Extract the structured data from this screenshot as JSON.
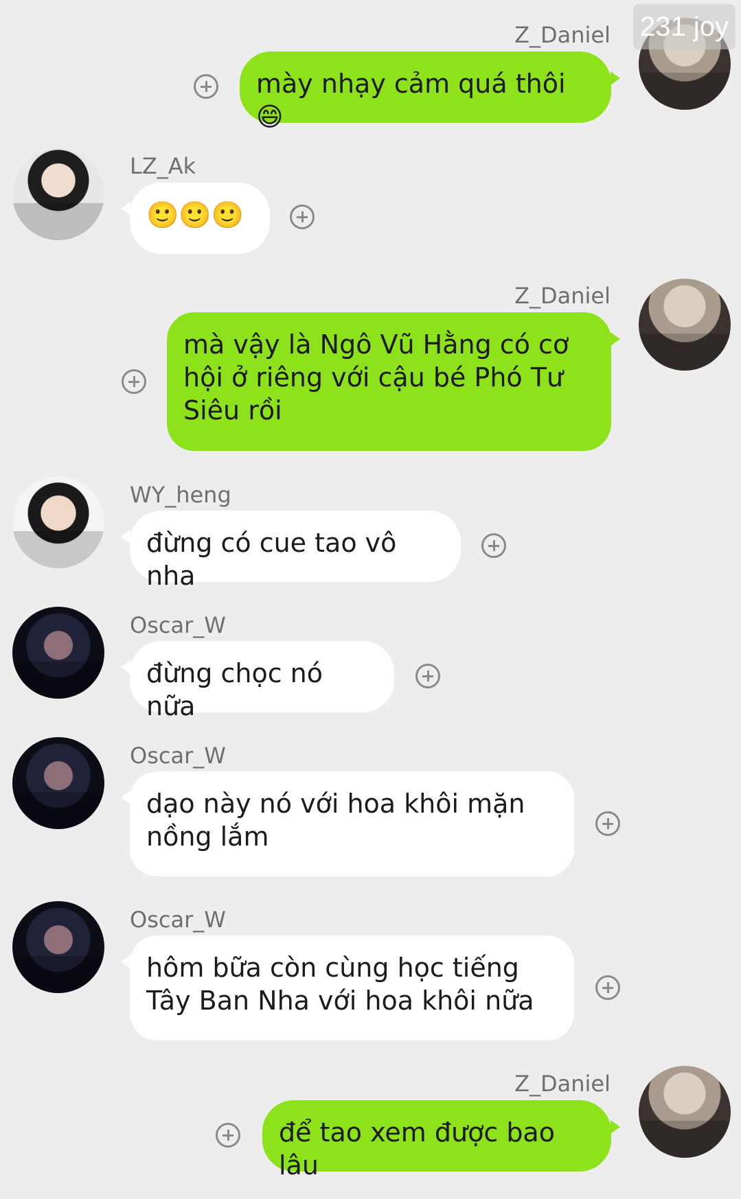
{
  "watermark": "231 joy",
  "messages": [
    {
      "sender": "Z_Daniel",
      "side": "right",
      "text": "mày nhạy cảm quá thôi 😄"
    },
    {
      "sender": "LZ_Ak",
      "side": "left",
      "text": "🙂🙂🙂"
    },
    {
      "sender": "Z_Daniel",
      "side": "right",
      "text": "mà vậy là Ngô Vũ Hằng có cơ hội ở riêng với cậu bé Phó Tư Siêu rồi"
    },
    {
      "sender": "WY_heng",
      "side": "left",
      "text": "đừng có cue tao vô nha"
    },
    {
      "sender": "Oscar_W",
      "side": "left",
      "text": "đừng chọc nó nữa"
    },
    {
      "sender": "Oscar_W",
      "side": "left",
      "text": "dạo này nó với hoa khôi mặn nồng lắm"
    },
    {
      "sender": "Oscar_W",
      "side": "left",
      "text": "hôm bữa còn cùng học tiếng Tây Ban Nha với hoa khôi nữa"
    },
    {
      "sender": "Z_Daniel",
      "side": "right",
      "text": "để tao xem được bao lâu"
    }
  ]
}
